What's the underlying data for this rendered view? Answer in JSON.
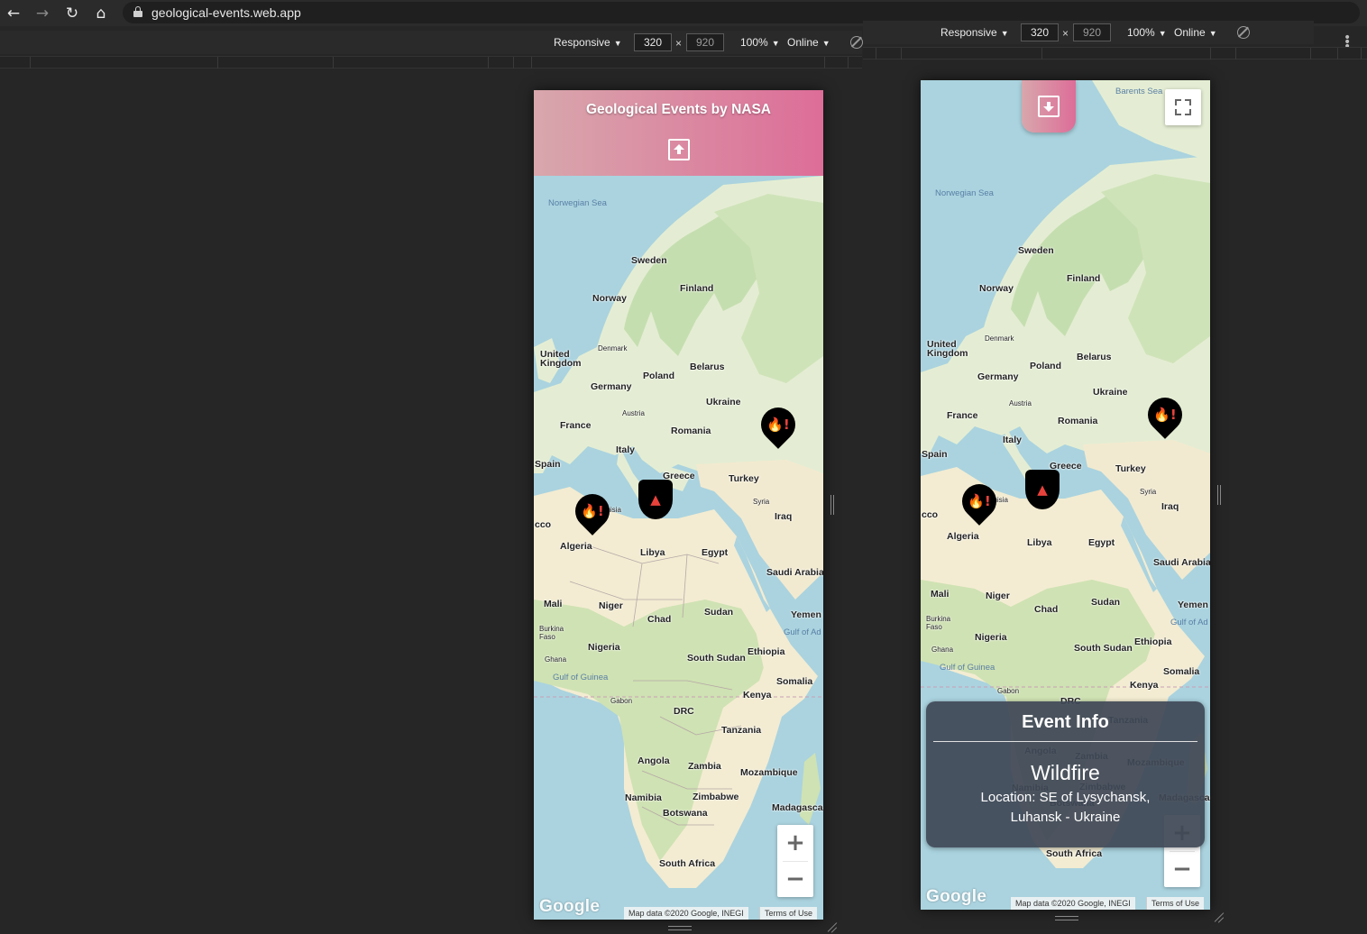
{
  "browser": {
    "url": "geological-events.web.app",
    "back_icon": "←",
    "forward_icon": "→",
    "reload_icon": "↻",
    "home_icon": "⌂"
  },
  "devtools": {
    "device": "Responsive",
    "width": "320",
    "height": "920",
    "times": "×",
    "zoom": "100%",
    "network": "Online",
    "caret": "▼"
  },
  "app": {
    "title": "Geological Events by NASA"
  },
  "map": {
    "labels": {
      "norwegian_sea": "Norwegian Sea",
      "sweden": "Sweden",
      "finland": "Finland",
      "norway": "Norway",
      "united_kingdom": "United Kingdom",
      "denmark": "Denmark",
      "poland": "Poland",
      "belarus": "Belarus",
      "germany": "Germany",
      "ukraine": "Ukraine",
      "france": "France",
      "austria": "Austria",
      "romania": "Romania",
      "italy": "Italy",
      "spain": "Spain",
      "greece": "Greece",
      "turkey": "Turkey",
      "syria": "Syria",
      "iraq": "Iraq",
      "tunisia_partial": "unisia",
      "morocco_partial": "cco",
      "algeria": "Algeria",
      "libya": "Libya",
      "egypt": "Egypt",
      "saudi_arabia": "Saudi Arabia",
      "mali": "Mali",
      "niger": "Niger",
      "chad": "Chad",
      "sudan": "Sudan",
      "yemen": "Yemen",
      "gulf_of_aden": "Gulf of Ad",
      "burkina_faso": "Burkina Faso",
      "nigeria": "Nigeria",
      "ethiopia": "Ethiopia",
      "south_sudan": "South Sudan",
      "ghana": "Ghana",
      "gulf_of_guinea": "Gulf of Guinea",
      "somalia": "Somalia",
      "gabon": "Gabon",
      "kenya": "Kenya",
      "drc": "DRC",
      "tanzania": "Tanzania",
      "angola": "Angola",
      "zambia": "Zambia",
      "mozambique": "Mozambique",
      "namibia": "Namibia",
      "zimbabwe": "Zimbabwe",
      "madagascar_partial": "Madagasca",
      "botswana": "Botswana",
      "south_africa": "South Africa",
      "barents_sea_partial": "Barents Sea"
    },
    "google_logo": "Google",
    "attribution": "Map data ©2020 Google, INEGI",
    "terms": "Terms of Use",
    "zoom_in": "+",
    "zoom_out": "−",
    "marker_wildfire_glyph": "🔥!",
    "marker_volcano_glyph": "▲",
    "colors": {
      "water": "#aad3df",
      "land": "#e9f0d9",
      "forest": "#c8dfb0",
      "desert": "#f3ecd2",
      "header_start": "#d8a7ac",
      "header_end": "#dd6d98",
      "marker": "#000000",
      "marker_glyph": "#e8423c"
    }
  },
  "event_info": {
    "heading": "Event Info",
    "title": "Wildfire",
    "location": "Location: SE of Lysychansk, Luhansk - Ukraine"
  }
}
